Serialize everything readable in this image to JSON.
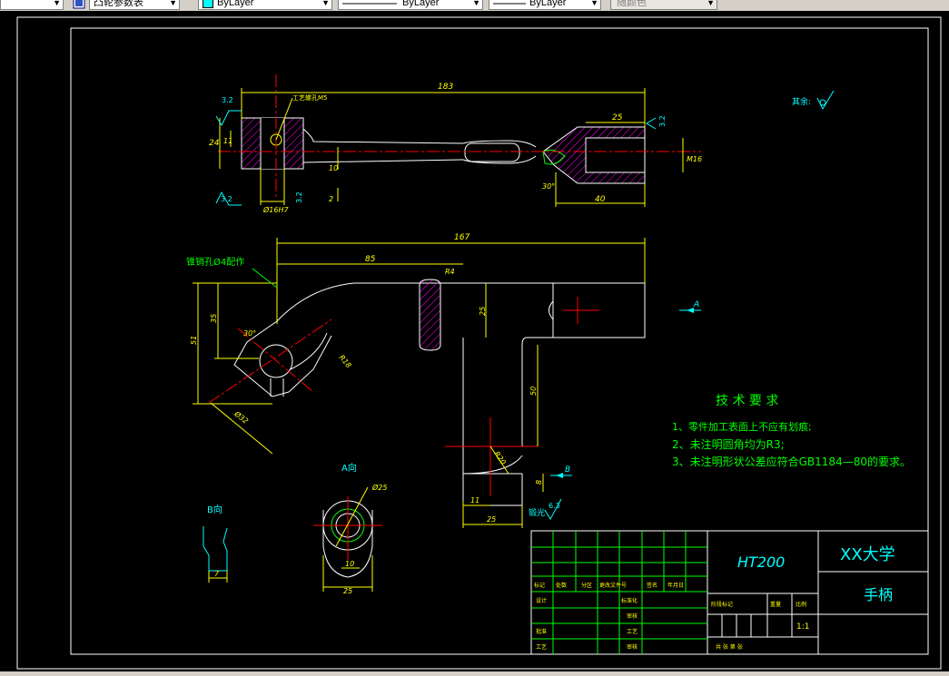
{
  "toolbar": {
    "combo1_text": "",
    "style_combo_text": "凸轮参数表",
    "color_combo_text": "ByLayer",
    "linetype_combo_text": "ByLayer",
    "lineweight_combo_text": "ByLayer",
    "plotstyle_combo_text": "随颜色"
  },
  "drawing": {
    "top_view": {
      "dim_overall": "183",
      "dim_right_len": "25",
      "dim_bottom_right": "40",
      "dim_left_height": "24",
      "dim_11": "11",
      "dim_10": "10",
      "dim_2": "2",
      "dim_bore": "Ø16H7",
      "dim_thread": "M16",
      "dim_angle": "30°",
      "label_tool_hole": "工艺螺孔M5",
      "rough_3_2_a": "3.2",
      "rough_3_2_b": "3.2",
      "rough_3_2_c": "3.2",
      "rough_3_2_d": "3.2",
      "rest_surface": "其余:"
    },
    "front_view": {
      "dim_167": "167",
      "dim_85": "85",
      "dim_R4": "R4",
      "dim_25": "25",
      "dim_51": "51",
      "dim_35": "35",
      "dim_30deg": "30°",
      "dim_R18": "R18",
      "dim_32": "Ø32",
      "dim_50": "50",
      "dim_R20": "R20",
      "dim_11": "11",
      "dim_25b": "25",
      "dim_8": "8",
      "view_arrow_A": "A",
      "view_arrow_B": "B",
      "note_pin_hole": "锥销孔Ø4配作",
      "rough_6_3": "6.3",
      "label_forge": "锻光"
    },
    "view_a": {
      "title": "A向",
      "dim_25dia": "Ø25",
      "dim_10": "10",
      "dim_25": "25"
    },
    "view_b": {
      "title": "B向",
      "dim_7": "7"
    },
    "tech_req": {
      "title": "技 术 要 求",
      "line1": "1、零件加工表面上不应有划痕;",
      "line2": "2、未注明圆角均为R3;",
      "line3": "3、未注明形状公差应符合GB1184—80的要求。"
    },
    "title_block": {
      "material": "HT200",
      "school": "XX大学",
      "part_name": "手柄",
      "scale": "1:1",
      "row_mark": "标记",
      "row_count": "处数",
      "row_zone": "分区",
      "row_doc": "更改文件号",
      "row_sign": "签名",
      "row_date": "年月日",
      "row_design": "设计",
      "row_std": "标准化",
      "row_check": "审核",
      "row_approve": "批准",
      "row_proc": "工艺",
      "row_craft": "工艺",
      "row_review": "审核",
      "col_stage": "阶段标记",
      "col_weight": "重量",
      "col_scale": "比例",
      "sheet": "共 张 第 张"
    }
  },
  "colors": {
    "line_white": "#ffffff",
    "dim_yellow": "#ffff00",
    "center_red": "#ff0000",
    "hatch_magenta": "#ff00ff",
    "tech_green": "#00ff00",
    "cyan": "#00ffff",
    "title_green": "#00ff00",
    "title_blue": "#00ffff"
  }
}
